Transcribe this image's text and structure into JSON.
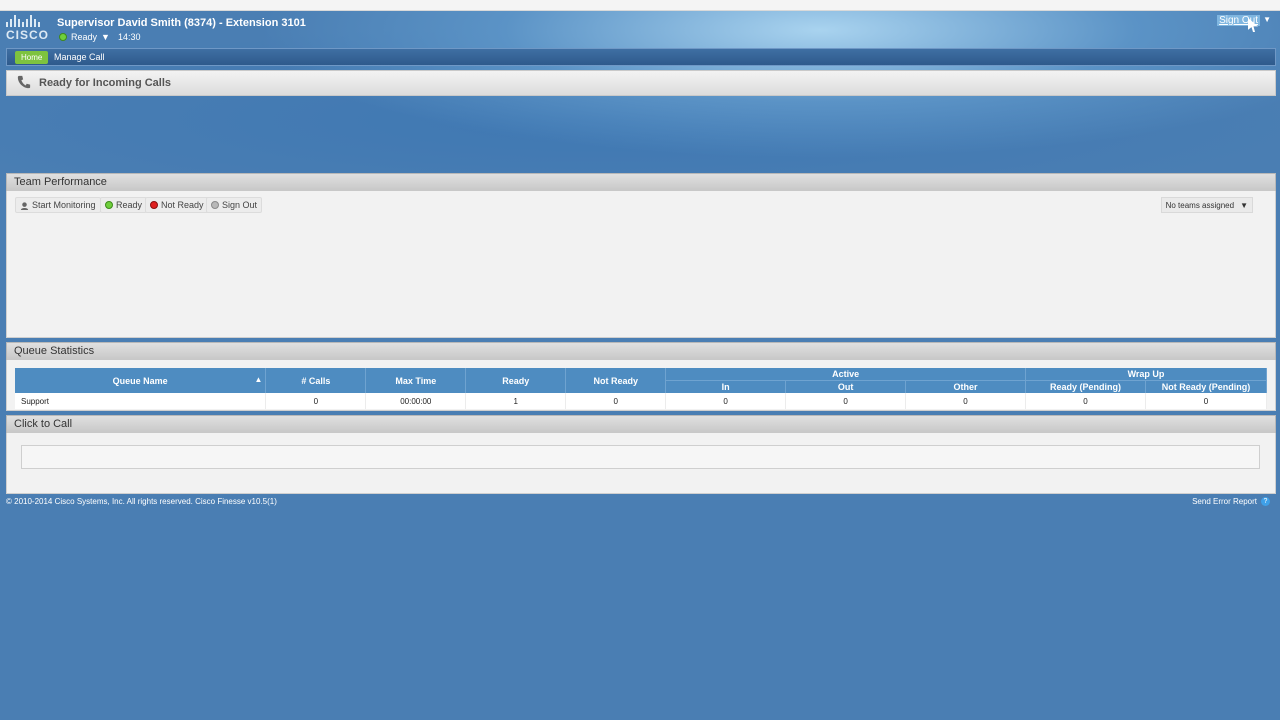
{
  "header": {
    "agent_name": "Supervisor David Smith (8374) - Extension 3101",
    "state": "Ready",
    "timer": "14:30",
    "sign_out": "Sign Out",
    "logo_text": "CISCO"
  },
  "nav": {
    "home": "Home",
    "manage_call": "Manage Call"
  },
  "status_bar": {
    "text": "Ready for Incoming Calls"
  },
  "team_performance": {
    "title": "Team Performance",
    "buttons": {
      "start_monitoring": "Start Monitoring",
      "ready": "Ready",
      "not_ready": "Not Ready",
      "sign_out": "Sign Out"
    },
    "teams_select": "No teams assigned"
  },
  "queue_statistics": {
    "title": "Queue Statistics",
    "headers": {
      "queue_name": "Queue Name",
      "calls": "# Calls",
      "max_time": "Max Time",
      "ready": "Ready",
      "not_ready": "Not Ready",
      "active": "Active",
      "in": "In",
      "out": "Out",
      "other": "Other",
      "wrap_up": "Wrap Up",
      "ready_pending": "Ready (Pending)",
      "not_ready_pending": "Not Ready (Pending)"
    },
    "rows": [
      {
        "name": "Support",
        "calls": "0",
        "max_time": "00:00:00",
        "ready": "1",
        "not_ready": "0",
        "in": "0",
        "out": "0",
        "other": "0",
        "ready_pending": "0",
        "not_ready_pending": "0"
      }
    ]
  },
  "click_to_call": {
    "title": "Click to Call"
  },
  "footer": {
    "copyright": "© 2010-2014 Cisco Systems, Inc. All rights reserved. Cisco Finesse v10.5(1)",
    "error_report": "Send Error Report"
  },
  "colors": {
    "accent_green": "#7ec33f",
    "table_header": "#4e8cc1",
    "background": "#4a7eb3"
  }
}
